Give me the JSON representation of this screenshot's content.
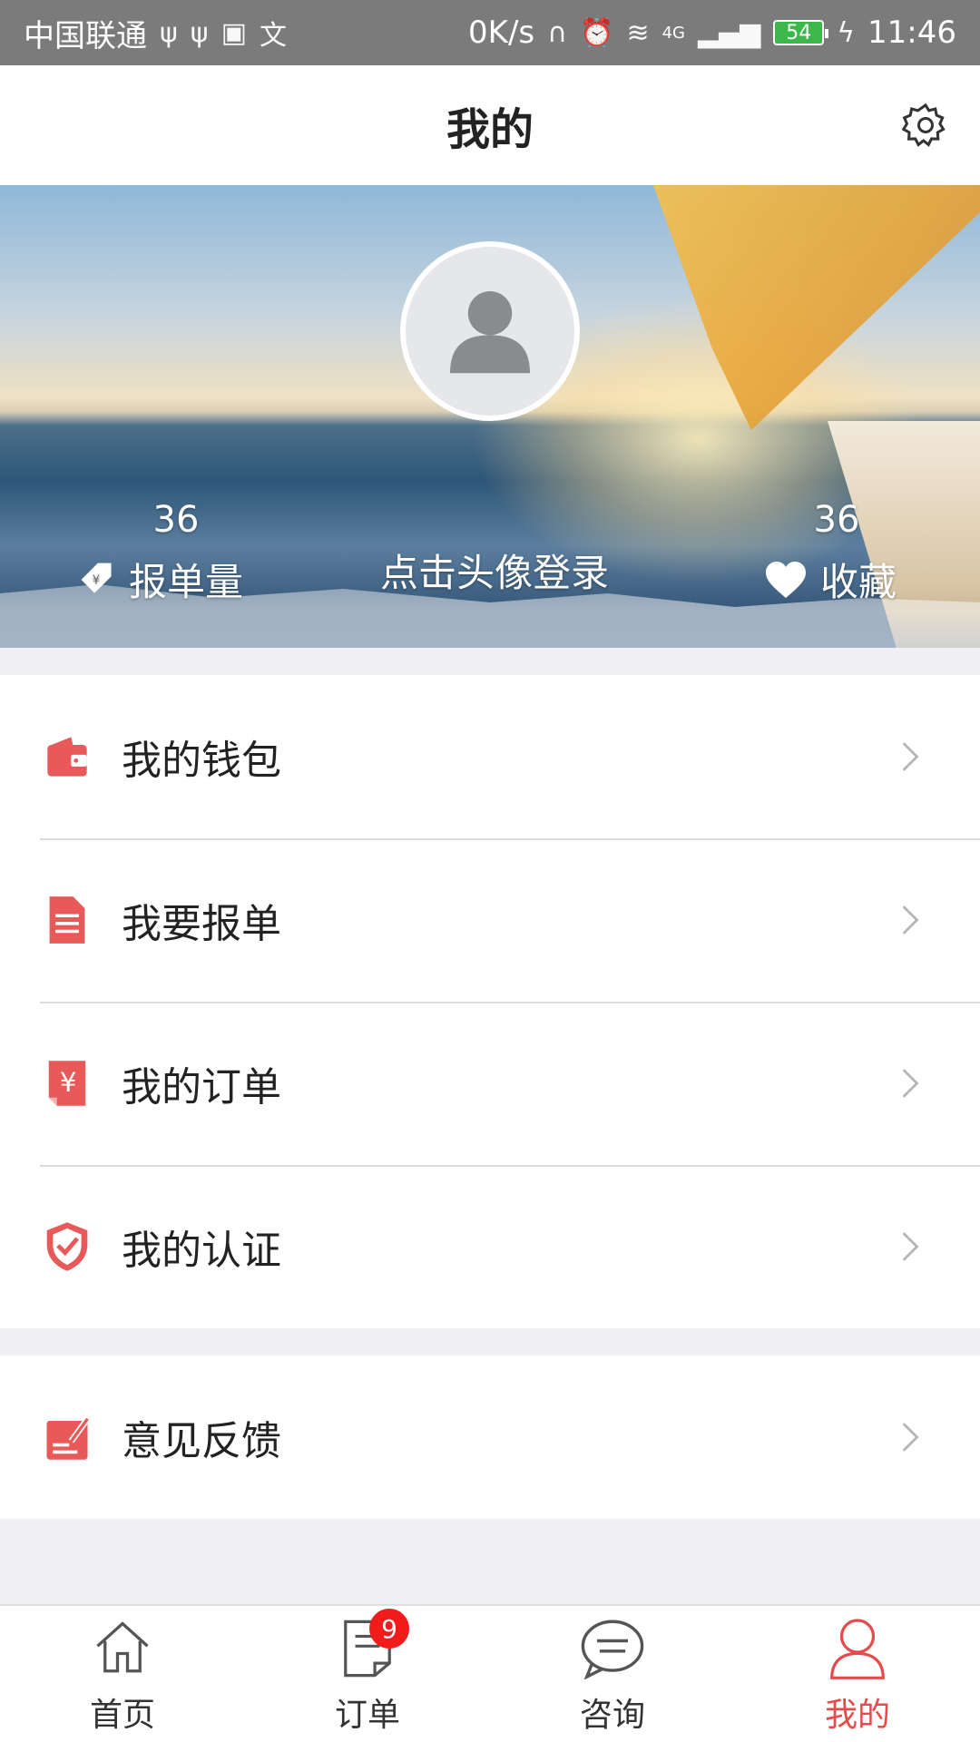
{
  "status_bar": {
    "carrier": "中国联通",
    "net_speed": "0K/s",
    "network": "4G",
    "battery": "54",
    "time": "11:46"
  },
  "header": {
    "title": "我的",
    "settings_icon": "gear-icon"
  },
  "profile": {
    "login_prompt": "点击头像登录",
    "left_stat": {
      "value": "36",
      "label": "报单量",
      "icon": "price-tag-icon"
    },
    "right_stat": {
      "value": "36",
      "label": "收藏",
      "icon": "heart-icon"
    }
  },
  "menu": {
    "group1": [
      {
        "label": "我的钱包",
        "icon": "wallet-icon"
      },
      {
        "label": "我要报单",
        "icon": "document-icon"
      },
      {
        "label": "我的订单",
        "icon": "yuan-order-icon"
      },
      {
        "label": "我的认证",
        "icon": "shield-check-icon"
      }
    ],
    "group2": [
      {
        "label": "意见反馈",
        "icon": "feedback-icon"
      }
    ]
  },
  "tabs": [
    {
      "label": "首页",
      "icon": "home-icon"
    },
    {
      "label": "订单",
      "icon": "order-icon",
      "badge": "9"
    },
    {
      "label": "咨询",
      "icon": "chat-icon"
    },
    {
      "label": "我的",
      "icon": "user-icon",
      "active": true
    }
  ],
  "colors": {
    "accent": "#e64b4b",
    "badge": "#f01b1b",
    "status_bar": "#7b7b7b",
    "background": "#efeff4"
  }
}
